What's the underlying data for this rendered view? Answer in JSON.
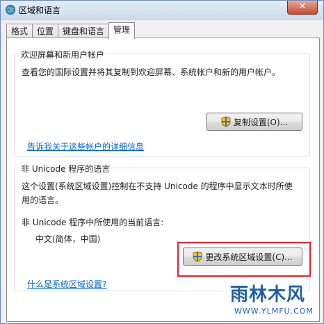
{
  "window": {
    "title": "区域和语言",
    "close_label": "✕"
  },
  "tabs": [
    {
      "label": "格式",
      "active": false
    },
    {
      "label": "位置",
      "active": false
    },
    {
      "label": "键盘和语言",
      "active": false
    },
    {
      "label": "管理",
      "active": true
    }
  ],
  "welcome_group": {
    "title": "欢迎屏幕和新用户帐户",
    "description": "查看您的国际设置并将其复制到欢迎屏幕、系统帐户和新的用户帐户。",
    "copy_button": "复制设置(O)...",
    "link": "告诉我关于这些帐户的详细信息"
  },
  "unicode_group": {
    "title": "非 Unicode 程序的语言",
    "description_line1": "这个设置(系统区域设置)控制在不支持 Unicode 的程序中显示文本时所使",
    "description_line2": "用的语言。",
    "current_label": "非 Unicode 程序中所使用的当前语言:",
    "current_value": "中文(简体，中国)",
    "change_button": "更改系统区域设置(C)...",
    "link": "什么是系统区域设置?"
  },
  "watermark": {
    "text": "雨林木风",
    "url": "WWW.YLMFU.COM"
  },
  "colors": {
    "accent": "#0066cc",
    "highlight": "#e0242b"
  }
}
